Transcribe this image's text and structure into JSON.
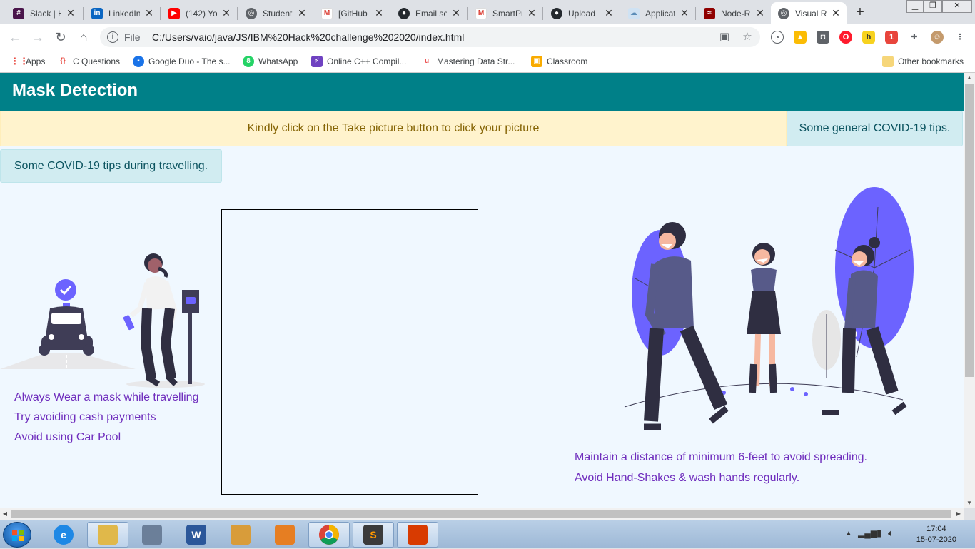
{
  "browser": {
    "tabs": [
      {
        "title": "Slack | H",
        "icon": "slack-icon",
        "color": "#4a154b"
      },
      {
        "title": "LinkedIn",
        "icon": "linkedin-icon",
        "color": "#0a66c2"
      },
      {
        "title": "(142) Yo",
        "icon": "youtube-icon",
        "color": "#ff0000"
      },
      {
        "title": "Student",
        "icon": "globe-icon",
        "color": "#5f6368"
      },
      {
        "title": "[GitHub",
        "icon": "gmail-icon",
        "color": "#d93025"
      },
      {
        "title": "Email se",
        "icon": "github-icon",
        "color": "#24292e"
      },
      {
        "title": "SmartPr",
        "icon": "gmail-icon",
        "color": "#d93025"
      },
      {
        "title": "Upload",
        "icon": "github-icon",
        "color": "#24292e"
      },
      {
        "title": "Applicat",
        "icon": "cloud-icon",
        "color": "#9fc5e8"
      },
      {
        "title": "Node-R",
        "icon": "node-red-icon",
        "color": "#8f0000"
      },
      {
        "title": "Visual R",
        "icon": "globe-icon",
        "color": "#5f6368"
      }
    ],
    "new_tab": "+",
    "url_scheme": "File",
    "url": "C:/Users/vaio/java/JS/IBM%20Hack%20challenge%202020/index.html",
    "bookmarks": [
      {
        "label": "Apps",
        "icon": "apps-grid-icon",
        "color": "#e8453c"
      },
      {
        "label": "C Questions",
        "icon": "braces-icon",
        "color": "#e8453c"
      },
      {
        "label": "Google Duo - The s...",
        "icon": "duo-icon",
        "color": "#1a73e8"
      },
      {
        "label": "WhatsApp",
        "icon": "whatsapp-icon",
        "color": "#25d366"
      },
      {
        "label": "Online C++ Compil...",
        "icon": "bolt-icon",
        "color": "#6f42c1"
      },
      {
        "label": "Mastering Data Str...",
        "icon": "udemy-icon",
        "color": "#ec5252"
      },
      {
        "label": "Classroom",
        "icon": "classroom-icon",
        "color": "#f9ab00"
      }
    ],
    "other_bookmarks": "Other bookmarks"
  },
  "page": {
    "title": "Mask Detection",
    "instruction": "Kindly click on the Take picture button to click your picture",
    "general_tips_button": "Some general COVID-19 tips.",
    "travel_tips_button": "Some COVID-19 tips during travelling.",
    "travel_tips": [
      "Always Wear a mask while travelling",
      "Try avoiding cash payments",
      "Avoid using Car Pool"
    ],
    "general_tips": [
      "Maintain a distance of minimum 6-feet to avoid spreading.",
      "Avoid Hand-Shakes & wash hands regularly."
    ],
    "colors": {
      "header": "#008088",
      "accent": "#6c63ff",
      "tip_text": "#6f2dbd"
    }
  },
  "taskbar": {
    "apps": [
      {
        "icon": "ie-icon",
        "color": "#1e88e5",
        "label": "e"
      },
      {
        "icon": "explorer-folder-icon",
        "color": "#e0b84a",
        "label": ""
      },
      {
        "icon": "laptop-icon",
        "color": "#6b7f99",
        "label": ""
      },
      {
        "icon": "word-icon",
        "color": "#2b579a",
        "label": "W"
      },
      {
        "icon": "window-icon",
        "color": "#d89c3a",
        "label": ""
      },
      {
        "icon": "office-tools-icon",
        "color": "#e67e22",
        "label": ""
      },
      {
        "icon": "chrome-icon",
        "color": "#34a853",
        "label": ""
      },
      {
        "icon": "sublime-icon",
        "color": "#3b3b3b",
        "label": "S"
      },
      {
        "icon": "office-icon",
        "color": "#d83b01",
        "label": ""
      }
    ],
    "time": "17:04",
    "date": "15-07-2020"
  }
}
